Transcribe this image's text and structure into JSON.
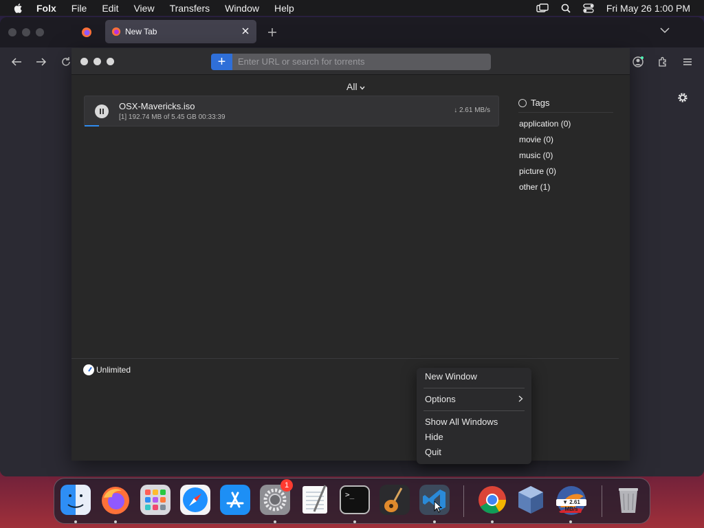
{
  "menubar": {
    "app_name": "Folx",
    "items": [
      "File",
      "Edit",
      "View",
      "Transfers",
      "Window",
      "Help"
    ],
    "clock": "Fri May 26  1:00 PM"
  },
  "browser": {
    "tab_title": "New Tab"
  },
  "folx": {
    "url_placeholder": "Enter URL or search for torrents",
    "filter_label": "All",
    "download": {
      "name": "OSX-Mavericks.iso",
      "details": "[1] 192.74 MB of 5.45 GB  00:33:39",
      "speed": "↓ 2.61 MB/s",
      "progress_fraction": 0.035
    },
    "tags": {
      "header": "Tags",
      "items": [
        "application (0)",
        "movie (0)",
        "music (0)",
        "picture (0)",
        "other (1)"
      ]
    },
    "speed_limit": "Unlimited"
  },
  "context_menu": {
    "items": [
      "New Window",
      "Options",
      "Show All Windows",
      "Hide",
      "Quit"
    ]
  },
  "dock": {
    "items": [
      "finder",
      "firefox",
      "launchpad",
      "safari",
      "app-store",
      "system-preferences",
      "textedit",
      "terminal",
      "garageband",
      "vscode",
      "chrome",
      "virtualbox",
      "folx",
      "trash"
    ],
    "system_preferences_badge": "1",
    "folx_speed_badge": "▼ 2.61 MB/s"
  },
  "colors": {
    "accent": "#2f6fd8",
    "progress": "#2f8cf0",
    "badge": "#ff3b30"
  }
}
